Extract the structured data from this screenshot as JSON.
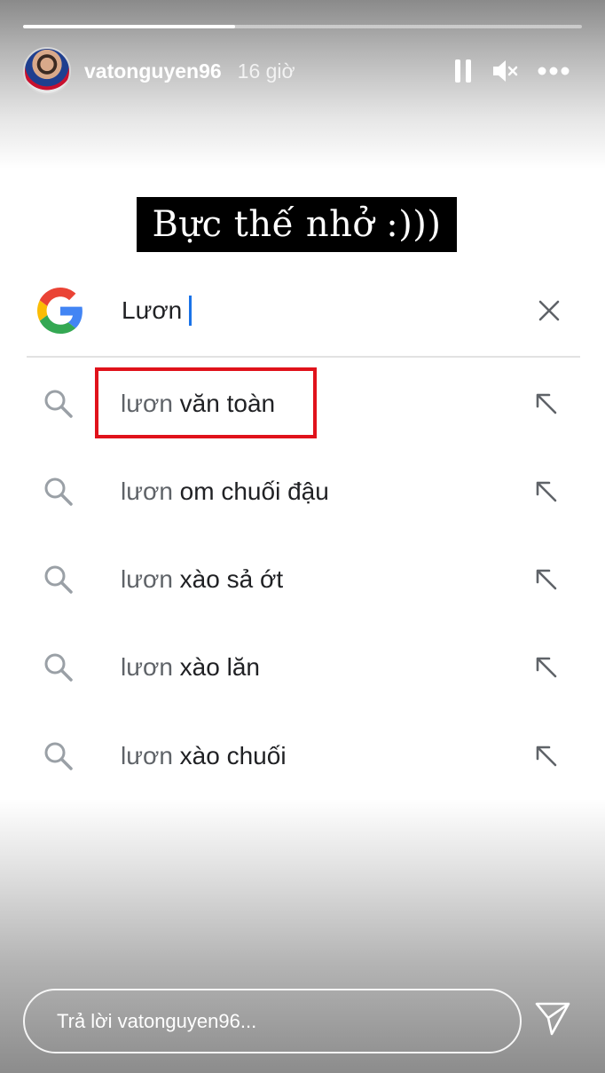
{
  "story": {
    "progress": 0.38,
    "username": "vatonguyen96",
    "time_ago": "16 giờ",
    "caption": "Bực thế nhở :)))"
  },
  "search": {
    "query": "Lươn",
    "suggestions": [
      {
        "prefix": "lươn",
        "rest": " văn toàn",
        "highlighted": true
      },
      {
        "prefix": "lươn",
        "rest": " om chuối đậu",
        "highlighted": false
      },
      {
        "prefix": "lươn",
        "rest": " xào sả ớt",
        "highlighted": false
      },
      {
        "prefix": "lươn",
        "rest": " xào lăn",
        "highlighted": false
      },
      {
        "prefix": "lươn",
        "rest": " xào chuối",
        "highlighted": false
      }
    ]
  },
  "reply": {
    "placeholder": "Trả lời vatonguyen96..."
  },
  "icons": {
    "pause": "pause-icon",
    "mute": "speaker-muted-icon",
    "more": "more-horizontal-icon",
    "google": "google-g-logo",
    "clear": "close-icon",
    "search": "search-icon",
    "fill_in": "arrow-up-left-icon",
    "send": "send-icon"
  },
  "colors": {
    "highlight_border": "#e0121b",
    "cursor": "#1a73e8",
    "caption_bg": "#000000"
  }
}
